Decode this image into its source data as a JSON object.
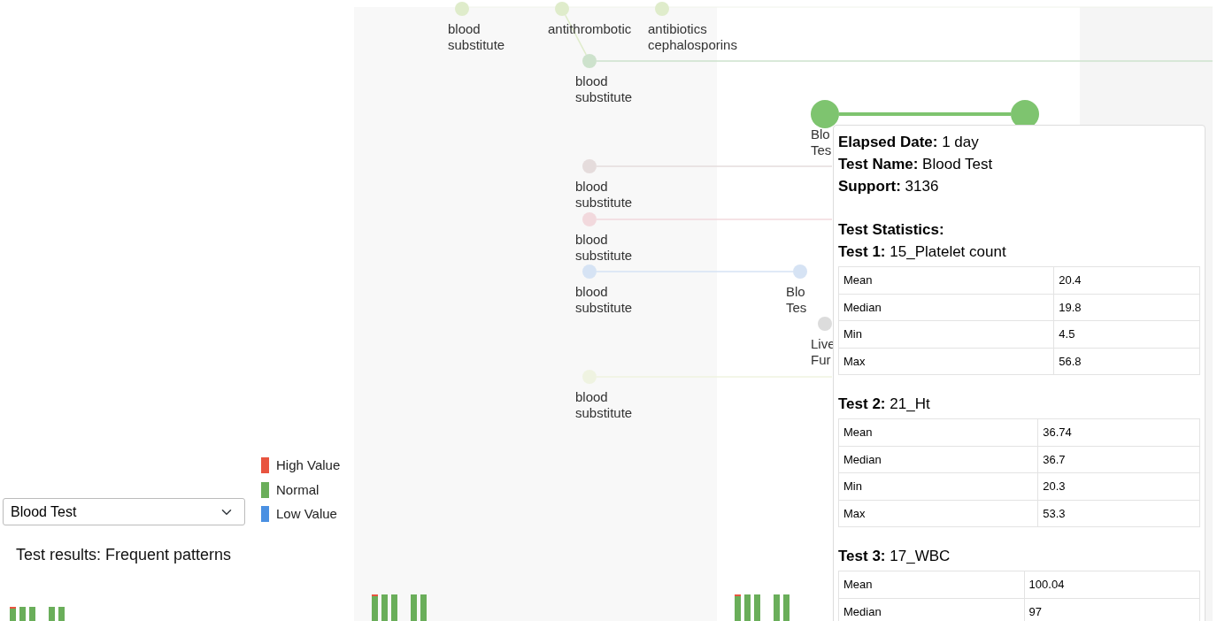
{
  "controls": {
    "test_select": "Blood Test",
    "title": "Test results: Frequent patterns"
  },
  "legend": [
    {
      "label": "High Value",
      "color": "#e8543f"
    },
    {
      "label": "Normal",
      "color": "#6aae5a"
    },
    {
      "label": "Low Value",
      "color": "#4a90e2"
    }
  ],
  "diagram": {
    "nodes": [
      {
        "label": "blood substitute",
        "color": "#dfeccb"
      },
      {
        "label": "antithrombotic",
        "color": "#dfeccb"
      },
      {
        "label": "antibiotics cephalosporins",
        "color": "#dfeccb"
      },
      {
        "label": "blood substitute",
        "color": "#cde2cc"
      },
      {
        "label": "Blo Tes",
        "color": "#7ec46f"
      },
      {
        "color": "#7ec46f"
      },
      {
        "label": "blood substitute",
        "color": "#e5dcdc"
      },
      {
        "label": "blood substitute",
        "color": "#f2d9dd"
      },
      {
        "label": "blood substitute",
        "color": "#d6e3f4"
      },
      {
        "label": "Blo Tes",
        "color": "#d6e3f4"
      },
      {
        "label": "Live Fur",
        "color": "#dcdcdc"
      },
      {
        "label": "blood substitute",
        "color": "#eff3e1"
      }
    ]
  },
  "tooltip": {
    "fields": [
      {
        "label": "Elapsed Date:",
        "value": "1 day"
      },
      {
        "label": "Test Name:",
        "value": "Blood Test"
      },
      {
        "label": "Support:",
        "value": "3136"
      }
    ],
    "stats_title": "Test Statistics:",
    "tests": [
      {
        "label": "Test 1:",
        "name": "15_Platelet count",
        "rows": [
          {
            "stat": "Mean",
            "value": "20.4"
          },
          {
            "stat": "Median",
            "value": "19.8"
          },
          {
            "stat": "Min",
            "value": "4.5"
          },
          {
            "stat": "Max",
            "value": "56.8"
          }
        ]
      },
      {
        "label": "Test 2:",
        "name": "21_Ht",
        "rows": [
          {
            "stat": "Mean",
            "value": "36.74"
          },
          {
            "stat": "Median",
            "value": "36.7"
          },
          {
            "stat": "Min",
            "value": "20.3"
          },
          {
            "stat": "Max",
            "value": "53.3"
          }
        ]
      },
      {
        "label": "Test 3:",
        "name": "17_WBC",
        "rows": [
          {
            "stat": "Mean",
            "value": "100.04"
          },
          {
            "stat": "Median",
            "value": "97"
          }
        ]
      }
    ]
  }
}
